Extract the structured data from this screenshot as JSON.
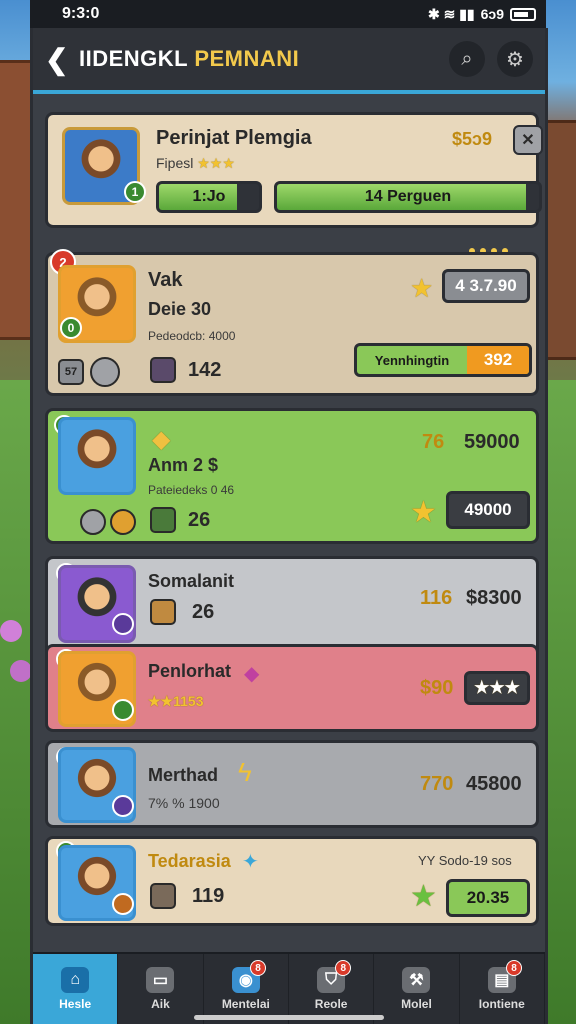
{
  "status": {
    "time": "9:3:0",
    "battery_text": "6ↄ9"
  },
  "header": {
    "title_part1": "IIDENGKL ",
    "title_part2": "PEMNANI"
  },
  "featured": {
    "name": "Perinjat Plemgia",
    "sub": "Fipesl",
    "stars": "★★★",
    "price": "$5ↄ9",
    "level_left": "1:Jo",
    "progress_label": "14 Perguen",
    "progress_value": 0.95,
    "close": "✕",
    "level": "1"
  },
  "rows": [
    {
      "name": "Vak",
      "line1": "Deie 30",
      "line2": "Pedeodcb: 4000",
      "badge": "2",
      "mini1": "57",
      "count": "142",
      "price": "4 3.7.90",
      "action_label": "Yennhingtin",
      "action_value": "392",
      "level": "0"
    },
    {
      "name": "Anm 2 $",
      "line2": "Pateiedeks 0 46",
      "count": "26",
      "value1": "76",
      "value2": "59000",
      "button": "49000"
    },
    {
      "name": "Somalanit",
      "count": "26",
      "value1": "116",
      "value2": "$8300"
    },
    {
      "name": "Penlorhat",
      "stars": "★★1153",
      "value1": "$90",
      "button_stars": "★★★"
    },
    {
      "name": "Merthad",
      "line2": "7% % 1900",
      "value1": "770",
      "value2": "45800"
    },
    {
      "name": "Tedarasia",
      "count": "119",
      "value1": "YY Sodo-19 sos",
      "button": "20.35"
    }
  ],
  "nav": [
    {
      "label": "Hesle",
      "icon": "home-icon",
      "badge": ""
    },
    {
      "label": "Aik",
      "icon": "chat-icon",
      "badge": ""
    },
    {
      "label": "Mentelai",
      "icon": "globe-icon",
      "badge": "8"
    },
    {
      "label": "Reole",
      "icon": "shield-icon",
      "badge": "8"
    },
    {
      "label": "Molel",
      "icon": "hammer-icon",
      "badge": ""
    },
    {
      "label": "Iontiene",
      "icon": "chest-icon",
      "badge": "8"
    }
  ]
}
